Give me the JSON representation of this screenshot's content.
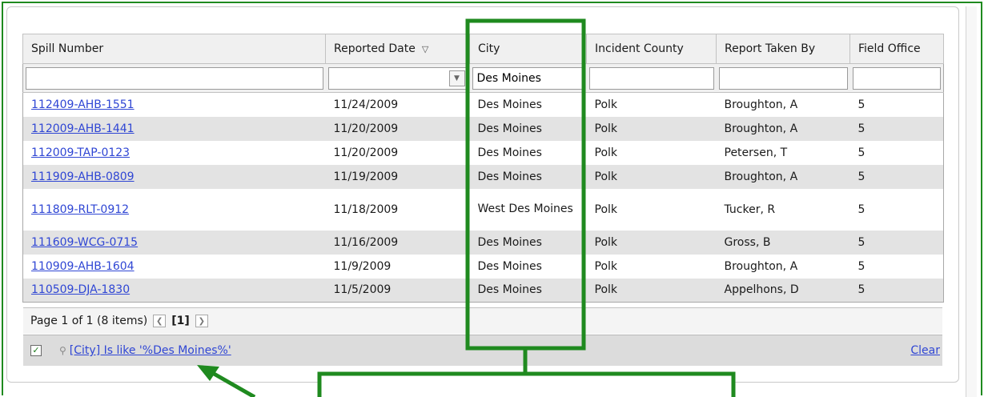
{
  "grid": {
    "columns": [
      {
        "label": "Spill Number"
      },
      {
        "label": "Reported Date",
        "sort_icon": "triangle-down-icon"
      },
      {
        "label": "City"
      },
      {
        "label": "Incident County"
      },
      {
        "label": "Report Taken By"
      },
      {
        "label": "Field Office"
      }
    ],
    "filters": {
      "spill_number": "",
      "reported_date": "",
      "city": "Des Moines",
      "incident_county": "",
      "report_taken_by": "",
      "field_office": ""
    },
    "rows": [
      {
        "spill_number": "112409-AHB-1551",
        "reported_date": "11/24/2009",
        "city": "Des Moines",
        "incident_county": "Polk",
        "report_taken_by": "Broughton, A",
        "field_office": "5"
      },
      {
        "spill_number": "112009-AHB-1441",
        "reported_date": "11/20/2009",
        "city": "Des Moines",
        "incident_county": "Polk",
        "report_taken_by": "Broughton, A",
        "field_office": "5"
      },
      {
        "spill_number": "112009-TAP-0123",
        "reported_date": "11/20/2009",
        "city": "Des Moines",
        "incident_county": "Polk",
        "report_taken_by": "Petersen, T",
        "field_office": "5"
      },
      {
        "spill_number": "111909-AHB-0809",
        "reported_date": "11/19/2009",
        "city": "Des Moines",
        "incident_county": "Polk",
        "report_taken_by": "Broughton, A",
        "field_office": "5"
      },
      {
        "spill_number": "111809-RLT-0912",
        "reported_date": "11/18/2009",
        "city": "West Des Moines",
        "incident_county": "Polk",
        "report_taken_by": "Tucker, R",
        "field_office": "5"
      },
      {
        "spill_number": "111609-WCG-0715",
        "reported_date": "11/16/2009",
        "city": "Des Moines",
        "incident_county": "Polk",
        "report_taken_by": "Gross, B",
        "field_office": "5"
      },
      {
        "spill_number": "110909-AHB-1604",
        "reported_date": "11/9/2009",
        "city": "Des Moines",
        "incident_county": "Polk",
        "report_taken_by": "Broughton, A",
        "field_office": "5"
      },
      {
        "spill_number": "110509-DJA-1830",
        "reported_date": "11/5/2009",
        "city": "Des Moines",
        "incident_county": "Polk",
        "report_taken_by": "Appelhons, D",
        "field_office": "5"
      }
    ]
  },
  "pager": {
    "summary": "Page 1 of 1 (8 items)",
    "prev_icon": "chevron-left-icon",
    "current_page": "[1]",
    "next_icon": "chevron-right-icon"
  },
  "filter_bar": {
    "enabled": true,
    "funnel_icon": "filter-icon",
    "expression": "[City] Is like '%Des Moines%'",
    "clear_label": "Clear"
  },
  "colors": {
    "annotation_green": "#1f8a1f",
    "link_blue": "#2f46d4",
    "alt_row": "#e3e3e3",
    "header_bg": "#f0f0f0"
  }
}
